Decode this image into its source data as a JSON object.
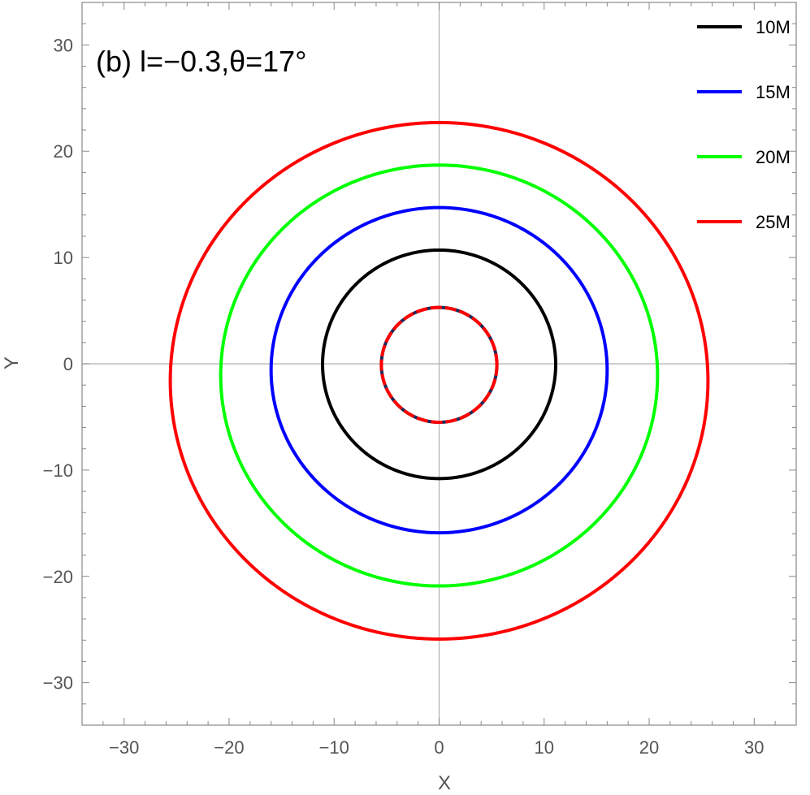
{
  "chart_data": {
    "type": "line",
    "title": "(b) l=−0.3,θ=17°",
    "xlabel": "X",
    "ylabel": "Y",
    "xlim": [
      -34,
      34
    ],
    "ylim": [
      -34,
      34
    ],
    "xticks": [
      -30,
      -20,
      -10,
      0,
      10,
      20,
      30
    ],
    "yticks": [
      -30,
      -20,
      -10,
      0,
      10,
      20,
      30
    ],
    "tick_labels_x": [
      "−30",
      "−20",
      "−10",
      "0",
      "10",
      "20",
      "30"
    ],
    "tick_labels_y": [
      "−30",
      "−20",
      "−10",
      "0",
      "10",
      "20",
      "30"
    ],
    "grid": false,
    "zero_lines": true,
    "legend_position": "top-right",
    "series": [
      {
        "name": "10M",
        "color": "#000000",
        "center": [
          0,
          -0.05
        ],
        "x_left": -11.1,
        "x_right": 11.1,
        "y_top": 10.7,
        "y_bottom": -10.8
      },
      {
        "name": "15M",
        "color": "#0000ff",
        "center": [
          0,
          -0.6
        ],
        "x_left": -16.0,
        "x_right": 16.0,
        "y_top": 14.7,
        "y_bottom": -15.9
      },
      {
        "name": "20M",
        "color": "#00ff00",
        "center": [
          0,
          -1.1
        ],
        "x_left": -20.8,
        "x_right": 20.8,
        "y_top": 18.7,
        "y_bottom": -20.9
      },
      {
        "name": "25M",
        "color": "#ff0000",
        "center": [
          0,
          -1.6
        ],
        "x_left": -25.6,
        "x_right": 25.6,
        "y_top": 22.7,
        "y_bottom": -25.9
      }
    ],
    "inner_shadow": {
      "center": [
        0,
        -0.1
      ],
      "x_left": -5.5,
      "x_right": 5.5,
      "y_top": 5.3,
      "y_bottom": -5.5,
      "dashed_colors": [
        "#ff0000"
      ],
      "underlay_color": "#1a2a5a"
    }
  }
}
